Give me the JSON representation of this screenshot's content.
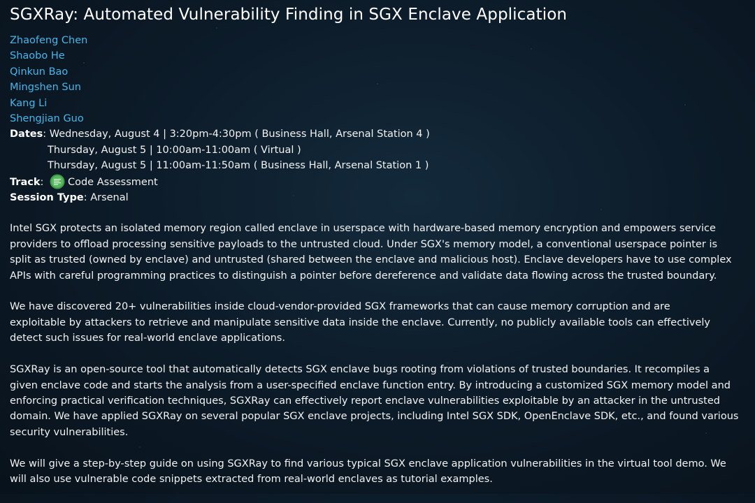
{
  "title": "SGXRay: Automated Vulnerability Finding in SGX Enclave Application",
  "authors": [
    "Zhaofeng Chen",
    "Shaobo He",
    "Qinkun Bao",
    "Mingshen Sun",
    "Kang Li",
    "Shengjian Guo"
  ],
  "dates": {
    "label": "Dates",
    "lines": [
      "Wednesday, August 4 | 3:20pm-4:30pm ( Business Hall, Arsenal Station 4 )",
      "Thursday, August 5 | 10:00am-11:00am ( Virtual )",
      "Thursday, August 5 | 11:00am-11:50am ( Business Hall, Arsenal Station 1 )"
    ]
  },
  "track": {
    "label": "Track",
    "value": "Code Assessment",
    "icon": "code-assessment-icon"
  },
  "session_type": {
    "label": "Session Type",
    "value": "Arsenal"
  },
  "description": {
    "p1": [
      "Intel SGX protects an isolated memory region called enclave in userspace with hardware-based memory encryption and empowers service",
      "providers to offload processing sensitive payloads to the untrusted cloud. Under SGX's memory model, a conventional userspace pointer is",
      "split as trusted (owned by enclave) and untrusted (shared between the enclave and malicious host). Enclave developers have to use complex",
      "APIs with careful programming practices to distinguish a pointer before dereference and validate data flowing across the trusted boundary."
    ],
    "p2": [
      "We have discovered 20+ vulnerabilities inside cloud-vendor-provided SGX frameworks that can cause memory corruption and are",
      "exploitable by attackers to retrieve and manipulate sensitive data inside the enclave. Currently, no publicly available tools can effectively",
      "detect such issues for real-world enclave applications."
    ],
    "p3": [
      "SGXRay is an open-source tool that automatically detects SGX enclave bugs rooting from violations of trusted boundaries. It recompiles a",
      "given enclave code and starts the analysis from a user-specified enclave function entry. By introducing a customized SGX memory model and",
      "enforcing practical verification techniques, SGXRay can effectively report enclave vulnerabilities exploitable by an attacker in the untrusted",
      "domain. We have applied SGXRay on several popular SGX enclave projects, including Intel SGX SDK, OpenEnclave SDK, etc., and found various",
      "security vulnerabilities."
    ],
    "p4": [
      "We will give a step-by-step guide on using SGXRay to find various typical SGX enclave application vulnerabilities in the virtual tool demo. We",
      "will also use vulnerable code snippets extracted from real-world enclaves as tutorial examples."
    ]
  },
  "colors": {
    "author_link": "#48b6ea",
    "track_icon": "#3f9a48",
    "text": "#f2f2f2"
  }
}
